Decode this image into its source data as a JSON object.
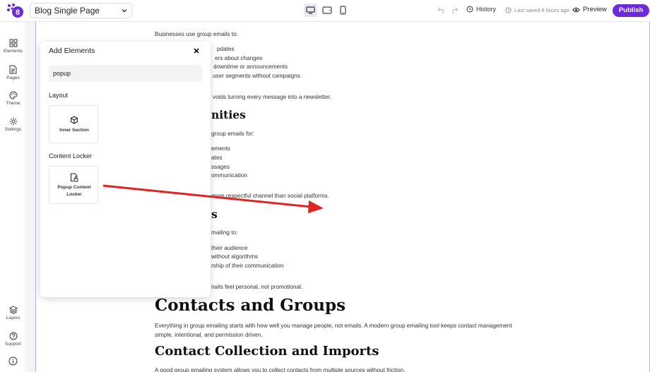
{
  "header": {
    "page_select": "Blog Single Page",
    "history_label": "History",
    "saved_label": "Last saved 8 hours ago",
    "preview_label": "Preview",
    "publish_label": "Publish"
  },
  "sidebar": {
    "items": [
      {
        "label": "Elements",
        "icon": "grid-icon"
      },
      {
        "label": "Pages",
        "icon": "page-icon"
      },
      {
        "label": "Theme",
        "icon": "palette-icon"
      },
      {
        "label": "Settings",
        "icon": "gear-icon"
      },
      {
        "label": "Layers",
        "icon": "layers-icon"
      },
      {
        "label": "Support",
        "icon": "help-icon"
      }
    ]
  },
  "panel": {
    "title": "Add Elements",
    "search_value": "popup",
    "sections": [
      {
        "label": "Layout",
        "cards": [
          {
            "label": "Inner Section",
            "icon": "cube-icon"
          }
        ]
      },
      {
        "label": "Content Locker",
        "cards": [
          {
            "label": "Popup Content Locker",
            "icon": "lock-doc-icon"
          }
        ]
      }
    ]
  },
  "article": {
    "lines": [
      "Businesses use group emails to:",
      "pdates",
      "ers about changes",
      "downtime or announcements",
      "user segments without campaigns",
      "voids turning every message into a newsletter.",
      "nities",
      "group emails for:",
      "ements",
      "ates",
      "ssages",
      "ommunication",
      "more respectful channel than social platforms.",
      "s",
      "mailing to:",
      "their audience",
      "without algorithms",
      "rship of their communication",
      "nails feel personal, not promotional.",
      "Contacts and Groups",
      "Everything in group emailing starts with how well you manage people, not emails. A modern group emailing tool keeps contact management",
      "simple, intentional, and permission driven.",
      "Contact Collection and Imports",
      "A good group emailing system allows you to collect contacts from multiple sources without friction."
    ]
  },
  "colors": {
    "accent": "#6c2bd9",
    "arrow": "#e02424",
    "canvas_border": "#b9b0f0"
  }
}
